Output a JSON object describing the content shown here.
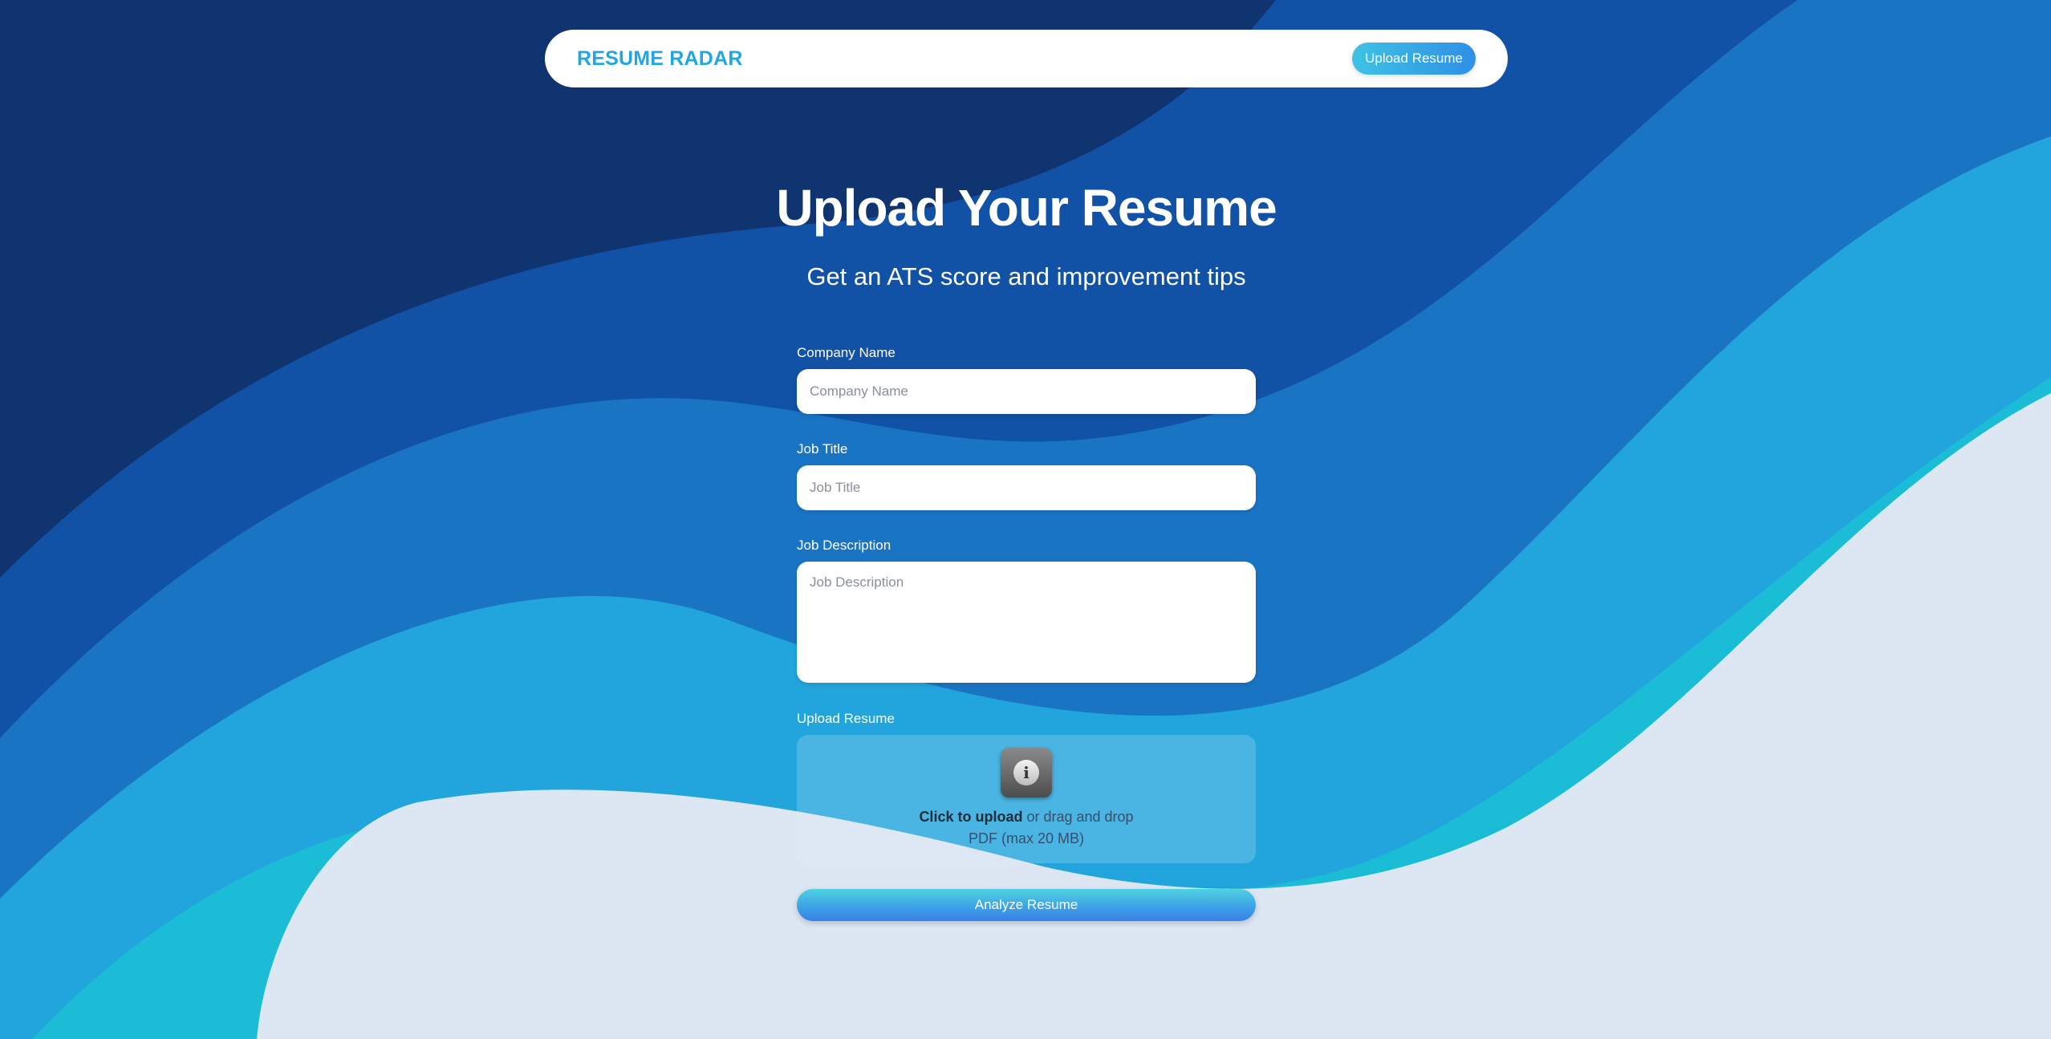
{
  "navbar": {
    "brand": "RESUME RADAR",
    "upload_button": "Upload Resume"
  },
  "hero": {
    "title": "Upload Your Resume",
    "subtitle": "Get an ATS score and improvement tips"
  },
  "form": {
    "company_name": {
      "label": "Company Name",
      "placeholder": "Company Name",
      "value": ""
    },
    "job_title": {
      "label": "Job Title",
      "placeholder": "Job Title",
      "value": ""
    },
    "job_description": {
      "label": "Job Description",
      "placeholder": "Job Description",
      "value": ""
    },
    "upload": {
      "label": "Upload Resume",
      "icon": "info-icon",
      "click_text": "Click to upload",
      "drag_text": " or drag and drop",
      "hint": "PDF (max 20 MB)"
    },
    "submit_label": "Analyze Resume"
  },
  "colors": {
    "brand": "#22a6e0",
    "bg_dark": "#0e3a7a",
    "wave_mid": "#1a6fc4",
    "wave_cyan": "#1bbcd6",
    "wave_light": "#dce6f3"
  }
}
